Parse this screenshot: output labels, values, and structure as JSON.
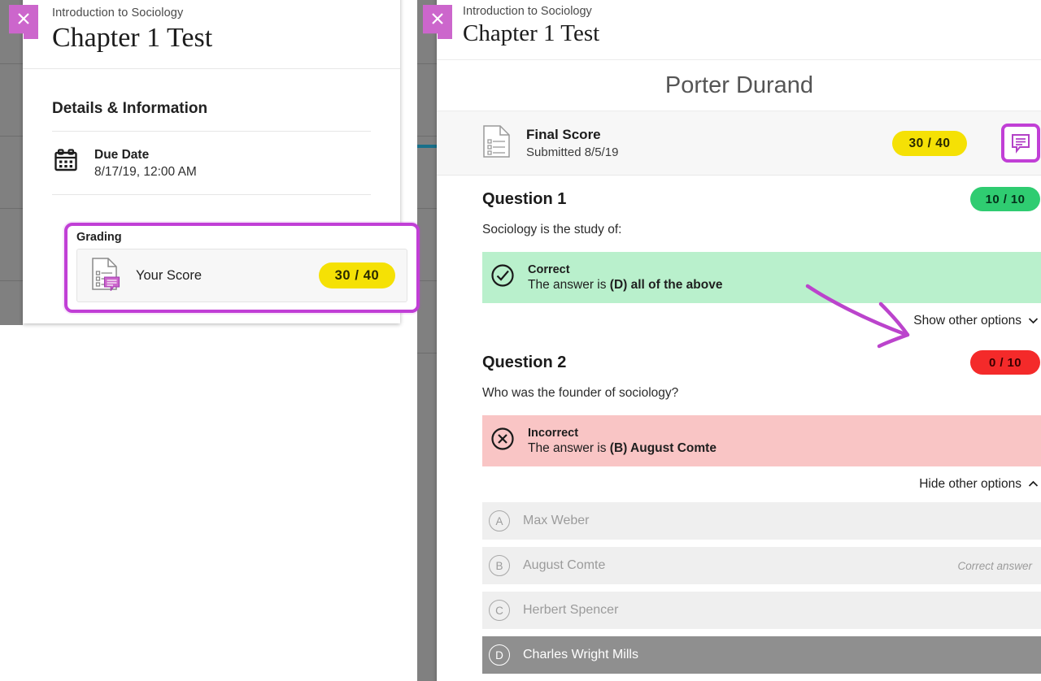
{
  "background": {
    "strip_color": "#808080",
    "accent_line_color": "#18708a"
  },
  "accent": {
    "highlight_purple": "#c13fd6",
    "close_purple": "#cc66cc",
    "yellow": "#f5e105",
    "green": "#2fcc71",
    "red": "#f42a2a",
    "correct_band": "#b9f0cc",
    "incorrect_band": "#f9c5c5"
  },
  "left_panel": {
    "close_icon": "close-icon",
    "course": "Introduction to Sociology",
    "title": "Chapter 1 Test",
    "section_title": "Details & Information",
    "due": {
      "icon": "calendar-icon",
      "label": "Due Date",
      "value": "8/17/19, 12:00 AM"
    },
    "grading": {
      "title": "Grading",
      "score_icon": "graded-document-icon",
      "score_label": "Your Score",
      "score_value": "30 / 40"
    }
  },
  "right_panel": {
    "close_icon": "close-icon",
    "course": "Introduction to Sociology",
    "title": "Chapter 1 Test",
    "student_name": "Porter Durand",
    "final_score": {
      "icon": "document-icon",
      "label": "Final Score",
      "submitted": "Submitted 8/5/19",
      "value": "30 / 40",
      "comment_icon": "comment-bubble-icon"
    },
    "questions": [
      {
        "title": "Question 1",
        "score": "10 / 10",
        "score_state": "correct",
        "prompt": "Sociology is the study of:",
        "result_state": "Correct",
        "result_icon": "check-circle-icon",
        "answer_prefix": "The answer is ",
        "answer_bold": "(D) all of the above",
        "toggle_label": "Show other options",
        "toggle_expanded": false,
        "options": []
      },
      {
        "title": "Question 2",
        "score": "0 / 10",
        "score_state": "incorrect",
        "prompt": "Who was the founder of sociology?",
        "result_state": "Incorrect",
        "result_icon": "x-circle-icon",
        "answer_prefix": "The answer is ",
        "answer_bold": "(B) August Comte",
        "toggle_label": "Hide other options",
        "toggle_expanded": true,
        "options": [
          {
            "letter": "A",
            "text": "Max Weber",
            "note": "",
            "selected": false
          },
          {
            "letter": "B",
            "text": "August Comte",
            "note": "Correct answer",
            "selected": false
          },
          {
            "letter": "C",
            "text": "Herbert Spencer",
            "note": "",
            "selected": false
          },
          {
            "letter": "D",
            "text": "Charles Wright Mills",
            "note": "",
            "selected": true
          }
        ]
      }
    ]
  },
  "annotations": {
    "arrow_icon": "hand-drawn-arrow-icon",
    "arrow_color": "#bb44cc"
  }
}
